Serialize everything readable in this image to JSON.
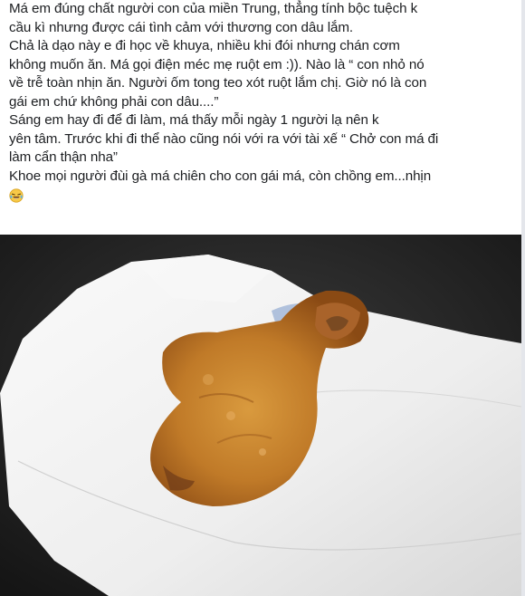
{
  "post": {
    "lines": [
      "Má em đúng chất người con của miền Trung, thẳng tính bộc tuệch k",
      "cầu kì nhưng được cái tình cảm với thương con dâu lắm.",
      "Chả là dạo này e đi học về khuya, nhiều khi đói nhưng chán cơm",
      "không muốn ăn. Má gọi điện méc mẹ ruột em :)). Nào là “ con nhỏ nó",
      "về trễ toàn nhịn ăn. Người ốm tong teo xót ruột lắm chị. Giờ nó là con",
      "gái em chứ không phải con dâu....”",
      "Sáng em hay đi         để đi làm, má thấy mỗi ngày 1 người lạ nên k",
      "yên tâm. Trước khi đi thể nào cũng nói với ra với tài xế “ Chở con má đi",
      "làm cẩn thận nha”",
      "Khoe mọi người đùi gà má chiên cho con gái má, còn chồng em...nhịn"
    ],
    "emoji": "laughing-crying-emoji"
  },
  "photo": {
    "subject": "fried-chicken-drumstick-on-napkin",
    "colors": {
      "background": "#1e1e1e",
      "napkin": "#f1f1f1",
      "chicken": "#c9822e",
      "chicken_dark": "#8a4a14"
    }
  }
}
